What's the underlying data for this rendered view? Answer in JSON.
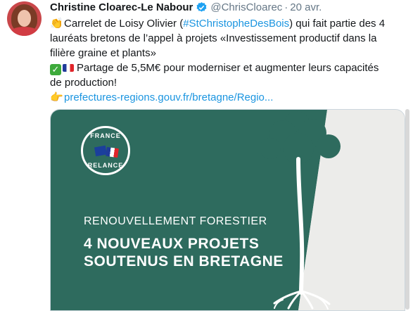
{
  "tweet": {
    "author_name": "Christine Cloarec-Le Nabour",
    "handle": "@ChrisCloarec",
    "separator": "·",
    "date": "20 avr.",
    "line1_prefix": "Carrelet de Loisy Olivier (",
    "hashtag": "#StChristopheDesBois",
    "line1_suffix": ") qui fait partie des 4",
    "line2": "lauréats bretons de l’appel à projets «Investissement productif dans la",
    "line3": "filière graine et plants»",
    "line4": "Partage de 5,5M€ pour moderniser et augmenter leurs capacités",
    "line5": "de production!",
    "link": "prefectures-regions.gouv.fr/bretagne/Regio..."
  },
  "card": {
    "badge_top": "FRANCE",
    "badge_bottom": "RELANCE",
    "kicker": "RENOUVELLEMENT FORESTIER",
    "headline_line1": "4 NOUVEAUX PROJETS",
    "headline_line2": "SOUTENUS EN BRETAGNE"
  },
  "icons": {
    "avatar": "author-avatar",
    "verified": "verified-badge-icon",
    "clap": "clapping-hands-emoji",
    "check": "check-mark-emoji",
    "flag": "france-flag-emoji",
    "pointer": "pointing-hand-emoji"
  },
  "colors": {
    "card_green": "#2e6b5e",
    "link_blue": "#1b95e0",
    "verified_blue": "#1da1f2"
  }
}
